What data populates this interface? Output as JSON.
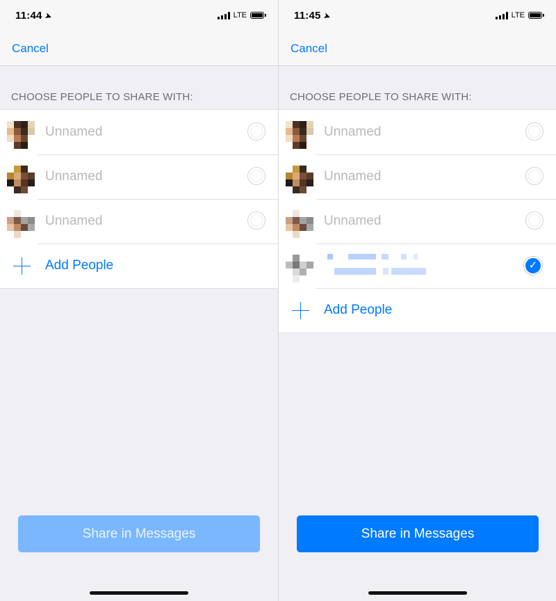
{
  "left": {
    "time": "11:44",
    "carrier": "LTE",
    "cancel": "Cancel",
    "section": "CHOOSE PEOPLE TO SHARE WITH:",
    "contacts": [
      {
        "name": "Unnamed",
        "selected": false
      },
      {
        "name": "Unnamed",
        "selected": false
      },
      {
        "name": "Unnamed",
        "selected": false
      }
    ],
    "add_people": "Add People",
    "share_button": "Share in Messages",
    "share_enabled": false
  },
  "right": {
    "time": "11:45",
    "carrier": "LTE",
    "cancel": "Cancel",
    "section": "CHOOSE PEOPLE TO SHARE WITH:",
    "contacts": [
      {
        "name": "Unnamed",
        "selected": false
      },
      {
        "name": "Unnamed",
        "selected": false
      },
      {
        "name": "Unnamed",
        "selected": false
      },
      {
        "name": "",
        "selected": true
      }
    ],
    "add_people": "Add People",
    "share_button": "Share in Messages",
    "share_enabled": true
  },
  "colors": {
    "accent": "#007aff",
    "disabled_button": "#7ab7ff",
    "background": "#efeff4",
    "placeholder_text": "#b9b9bd"
  },
  "icons": [
    "location-arrow-icon",
    "signal-bars-icon",
    "battery-icon",
    "plus-icon",
    "radio-unselected-icon",
    "checkmark-selected-icon"
  ]
}
